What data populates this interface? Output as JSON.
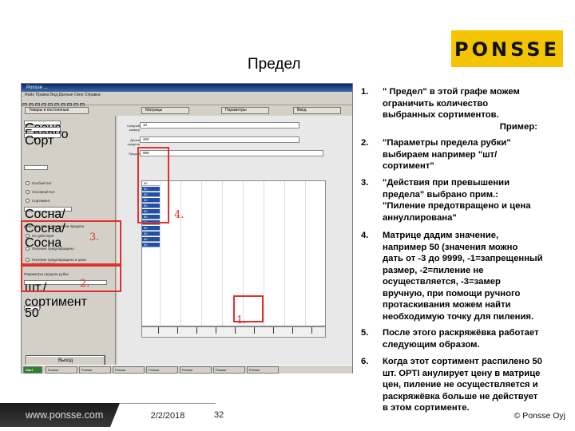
{
  "slide_title": "Предел",
  "logo_text": "PONSSE",
  "screenshot": {
    "window_title": "Ponsse ...",
    "menu": "Файл Правка Вид Данные Окно Справка",
    "tabs": [
      "Товары и постоянные",
      "Матрицы",
      "Параметры",
      "Ввод"
    ],
    "input_rows": [
      {
        "label": "Средний размер",
        "value": "10"
      },
      {
        "label": "Длина предела",
        "value": "320"
      },
      {
        "label": "Предел",
        "value": "999"
      }
    ],
    "grid_values": [
      "50",
      "50",
      "50",
      "50",
      "50",
      "50",
      "50",
      "50",
      "50",
      "50",
      "50",
      "50"
    ],
    "left_pane": {
      "fields": [
        "Сосна",
        "Бревно",
        "Сорт"
      ],
      "radios": [
        "Особый пит",
        "Основной пит",
        "Сортимент"
      ],
      "select_sortiment": "Сосна/Сосна/Сосна",
      "cut_options_title": "Действия при превышении предела",
      "cut_options": [
        "Не действует",
        "Пиление предотвращено",
        "Пиление предотвращено и цена аннулирована"
      ],
      "param_label": "Параметры предела рубки",
      "param_value": "шт./сортимент",
      "extra_field": "50",
      "exit_button": "Выход"
    },
    "taskbar_items": [
      "Start",
      "Ponsse",
      "Ponsse",
      "Ponsse",
      "Ponsse",
      "Ponsse",
      "Ponsse",
      "Ponsse"
    ]
  },
  "markers": {
    "m1": "1.",
    "m2": "2.",
    "m3": "3.",
    "m4": "4."
  },
  "list": [
    {
      "num": "1.",
      "lines": [
        "\" Предел\" в этой графе можем",
        "ограничить количество",
        "выбранных сортиментов."
      ],
      "right_line": "Пример:"
    },
    {
      "num": "2.",
      "lines": [
        "\"Параметры предела рубки\"",
        "выбираем например \"шт/",
        "сортимент\""
      ]
    },
    {
      "num": "3.",
      "lines": [
        "\"Действия при превышении",
        "предела\" выбрано прим.:",
        "\"Пиление предотвращено и цена",
        "аннуллирована\""
      ]
    },
    {
      "num": "4.",
      "lines": [
        "Матрице дадим значение,",
        "например 50 (значения можно",
        "дать от -3 до 9999, -1=запрещенный",
        "размер, -2=пиление не",
        "осуществляется, -3=замер",
        "вручную, при помощи ручного",
        "протаскивания можем найти",
        "необходимую точку для пиления."
      ]
    },
    {
      "num": "5.",
      "lines": [
        " После этого раскряжёвка работает",
        "следующим образом."
      ]
    },
    {
      "num": "6.",
      "lines": [
        "Когда этот сортимент распилено 50",
        "шт. OPTI анулирует цену в матрице",
        "цен, пиление не осуществляется и",
        "раскряжёвка больше не действует",
        "в этом сортименте."
      ]
    }
  ],
  "footer": {
    "website": "www.ponsse.com",
    "date": "2/2/2018",
    "page": "32",
    "copyright": "© Ponsse Oyj"
  }
}
